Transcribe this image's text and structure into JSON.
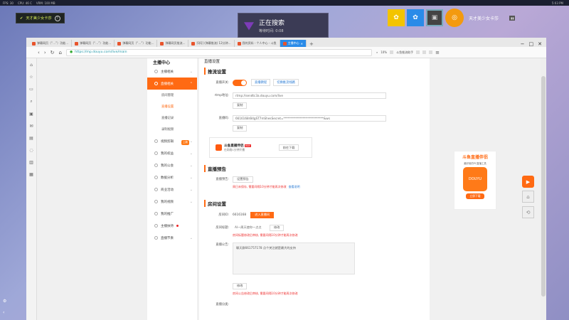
{
  "top_strip": {
    "items": [
      "FPS: 30",
      "CPU: 46 C",
      "VRM: 100 MB"
    ],
    "clock": "5:03 PM"
  },
  "streamer_tag": {
    "name": "天才美少女卡莎"
  },
  "search_overlay": {
    "status": "正在搜索",
    "wait": "等待时间: 0:08"
  },
  "user": {
    "name": "天才美少女卡莎"
  },
  "browser": {
    "tabs": [
      "弹幕网页（“…”）功能…",
      "弹幕网页（“…”）功能…",
      "弹幕网页（“…”）功能…",
      "弹幕网页推流…",
      "[QQ] (弹幕推流) 12分钟…",
      "我的资料 - 个人中心 - 斗鱼",
      "主播中心"
    ],
    "url": "https://mp.douyu.com/live/main",
    "zoom": "10%",
    "right_label": "斗鱼推流助手"
  },
  "sidebar": {
    "title": "主播中心",
    "items": [
      {
        "label": "主播相关"
      },
      {
        "label": "直播相关"
      },
      {
        "label": "视频剪辑"
      },
      {
        "label": "我的权益"
      },
      {
        "label": "我的公会"
      },
      {
        "label": "数据分析"
      },
      {
        "label": "商业活动"
      },
      {
        "label": "我的视频"
      },
      {
        "label": "我的推广"
      },
      {
        "label": "主播扶持"
      },
      {
        "label": "直播节奏"
      }
    ],
    "subitems": [
      "房间管理",
      "直播设置",
      "直播记录",
      "录制视频"
    ],
    "new_tag": "上新"
  },
  "main": {
    "page_heading": "直播设置",
    "push": {
      "title": "推流设置",
      "switch_label": "直播开关:",
      "link1": "直播教程",
      "link2": "切换推流线路",
      "rtmp_label": "rtmp地址:",
      "rtmp_value": "rtmp://sendtc3a.douyu.com/live",
      "copy": "复制",
      "code_label": "直播码:",
      "code_value": "6616168rB4gST7mShesSecret=***************************&ws",
      "copy2": "复制"
    },
    "promo": {
      "title": "斗鱼直播伴侣",
      "hot": "HOT",
      "sub": "在网络1分钟开播",
      "button": "前往下载"
    },
    "preview": {
      "title": "直播预告",
      "label": "直播预告:",
      "button": "设置预告",
      "warn": "周日未保存, 需要间隔10分钟才能再次修改",
      "link": "查看说明"
    },
    "room": {
      "title": "房间设置",
      "id_label": "房间ID:",
      "id_value": "6616168",
      "enter_btn": "进入直播间",
      "name_label": "房间标题:",
      "name_value": "AI一周天使你一点点",
      "edit": "修改",
      "warn1": "房间标题修改后审核, 需要间隔10分钟才能再次修改",
      "notice_label": "直播公告:",
      "notice_value": "聊天群661757178  点个关注就是最大的支持",
      "edit2": "修改",
      "warn2": "房间公告修改后审核, 需要间隔10分钟才能再次修改",
      "cate_label": "直播分类:"
    }
  },
  "ad": {
    "title": "斗鱼直播伴侣",
    "sub": "最好用的PC直播工具",
    "app": "DOUYU",
    "download": "立即下载"
  },
  "colors": {
    "accent": "#ff6a13",
    "link": "#2a7bd4"
  }
}
